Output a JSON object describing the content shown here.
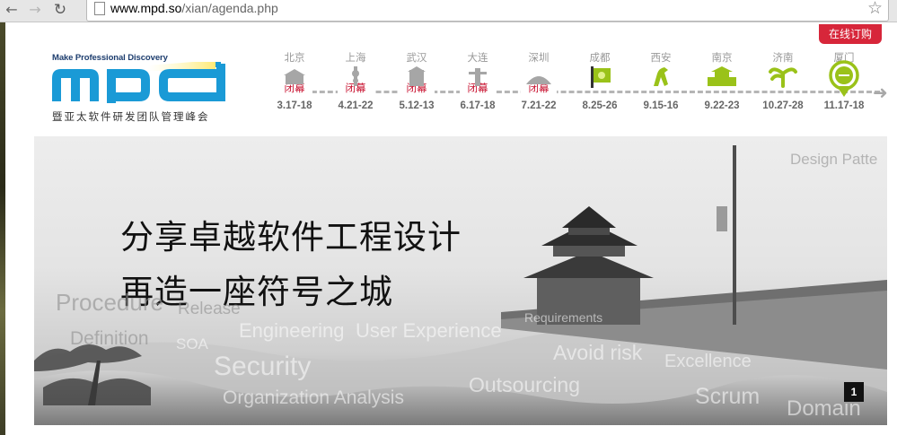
{
  "browser": {
    "url_host": "www.mpd.so",
    "url_path": "/xian/agenda.php"
  },
  "header": {
    "order_button": "在线订购",
    "logo": {
      "tagline": "Make Professional Discovery",
      "letters": "mpd",
      "subtitle": "暨亚太软件研发团队管理峰会"
    }
  },
  "timeline": {
    "cities": [
      {
        "name": "北京",
        "status": "闭幕",
        "date": "3.17-18",
        "icon": "beijing-landmark-icon",
        "closed": true
      },
      {
        "name": "上海",
        "status": "闭幕",
        "date": "4.21-22",
        "icon": "shanghai-tower-icon",
        "closed": true
      },
      {
        "name": "武汉",
        "status": "闭幕",
        "date": "5.12-13",
        "icon": "wuhan-tower-icon",
        "closed": true
      },
      {
        "name": "大连",
        "status": "闭幕",
        "date": "6.17-18",
        "icon": "dalian-monument-icon",
        "closed": true
      },
      {
        "name": "深圳",
        "status": "闭幕",
        "date": "7.21-22",
        "icon": "shenzhen-building-icon",
        "closed": true
      },
      {
        "name": "成都",
        "status": "",
        "date": "8.25-26",
        "icon": "chengdu-flag-icon",
        "closed": false
      },
      {
        "name": "西安",
        "status": "",
        "date": "9.15-16",
        "icon": "xian-horse-icon",
        "closed": false
      },
      {
        "name": "南京",
        "status": "",
        "date": "9.22-23",
        "icon": "nanjing-gate-icon",
        "closed": false
      },
      {
        "name": "济南",
        "status": "",
        "date": "10.27-28",
        "icon": "jinan-spring-icon",
        "closed": false
      },
      {
        "name": "厦门",
        "status": "",
        "date": "11.17-18",
        "icon": "xiamen-marker-icon",
        "closed": false
      }
    ]
  },
  "banner": {
    "slogan_line1": "分享卓越软件工程设计",
    "slogan_line2": "再造一座符号之城",
    "slide_number": "1",
    "words": [
      "Design Patte",
      "Procedure",
      "Release",
      "Definition",
      "SOA",
      "Engineering",
      "User Experience",
      "Requirements",
      "Security",
      "Avoid risk",
      "Excellence",
      "Outsourcing",
      "Organization Analysis",
      "Scrum",
      "Domain"
    ]
  },
  "colors": {
    "accent_red": "#d7263a",
    "closed_red": "#c8102e",
    "logo_blue": "#1a9ad6",
    "icon_green": "#9ac219",
    "inactive_gray": "#a6a6a6"
  }
}
